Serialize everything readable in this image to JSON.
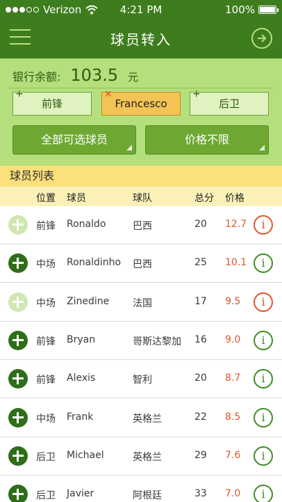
{
  "status_bar": {
    "carrier": "Verizon",
    "time": "4:21 PM",
    "battery": "100%",
    "battery_level": 1.0
  },
  "nav": {
    "title": "球员转入"
  },
  "balance": {
    "label": "银行余额:",
    "value": "103.5",
    "unit": "元"
  },
  "position_tabs": [
    {
      "label": "前锋",
      "mark": "+",
      "selected": false
    },
    {
      "label": "Francesco",
      "mark": "×",
      "selected": true
    },
    {
      "label": "后卫",
      "mark": "+",
      "selected": false
    }
  ],
  "filters": {
    "players_button": "全部可选球员",
    "price_button": "价格不限"
  },
  "list": {
    "title": "球员列表",
    "columns": {
      "position": "位置",
      "player": "球员",
      "team": "球队",
      "score": "总分",
      "price": "价格"
    },
    "rows": [
      {
        "position": "前锋",
        "player": "Ronaldo",
        "team": "巴西",
        "score": "20",
        "price": "12.7",
        "addable": false,
        "info_alert": true
      },
      {
        "position": "中场",
        "player": "Ronaldinho",
        "team": "巴西",
        "score": "25",
        "price": "10.1",
        "addable": true,
        "info_alert": false
      },
      {
        "position": "中场",
        "player": "Zinedine",
        "team": "法国",
        "score": "17",
        "price": "9.5",
        "addable": false,
        "info_alert": true
      },
      {
        "position": "前锋",
        "player": "Bryan",
        "team": "哥斯达黎加",
        "score": "16",
        "price": "9.0",
        "addable": true,
        "info_alert": false
      },
      {
        "position": "前锋",
        "player": "Alexis",
        "team": "智利",
        "score": "20",
        "price": "8.7",
        "addable": true,
        "info_alert": false
      },
      {
        "position": "中场",
        "player": "Frank",
        "team": "英格兰",
        "score": "22",
        "price": "8.5",
        "addable": true,
        "info_alert": false
      },
      {
        "position": "后卫",
        "player": "Michael",
        "team": "英格兰",
        "score": "29",
        "price": "7.6",
        "addable": true,
        "info_alert": false
      },
      {
        "position": "后卫",
        "player": "Javier",
        "team": "阿根廷",
        "score": "33",
        "price": "7.0",
        "addable": true,
        "info_alert": false
      }
    ]
  },
  "icons": {
    "menu": "hamburger-icon",
    "next": "arrow-right-circle-icon",
    "add": "plus-circle-icon",
    "info": "info-circle-icon"
  },
  "colors": {
    "header": "#3e7d1e",
    "panel": "#b5df7c",
    "section": "#fbe07c",
    "price": "#e0562b",
    "accent": "#3f8c26"
  }
}
